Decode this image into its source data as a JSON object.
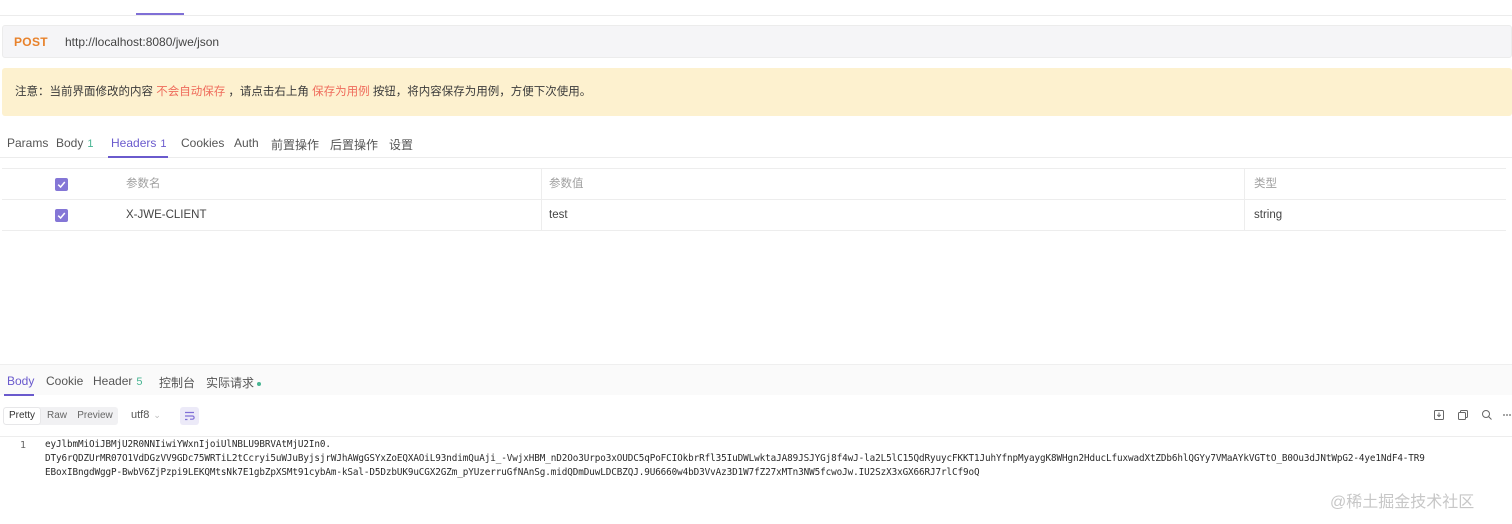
{
  "request": {
    "method": "POST",
    "url": "http://localhost:8080/jwe/json"
  },
  "notice": {
    "prefix": "注意：当前界面修改的内容",
    "warn": "不会自动保存",
    "middle": "，请点击右上角",
    "action": "保存为用例",
    "suffix": "按钮，将内容保存为用例，方便下次使用。"
  },
  "request_tabs": [
    {
      "label": "Params",
      "count": ""
    },
    {
      "label": "Body",
      "count": "1"
    },
    {
      "label": "Headers",
      "count": "1"
    },
    {
      "label": "Cookies",
      "count": ""
    },
    {
      "label": "Auth",
      "count": ""
    },
    {
      "label": "前置操作",
      "count": ""
    },
    {
      "label": "后置操作",
      "count": ""
    },
    {
      "label": "设置",
      "count": ""
    }
  ],
  "headers_table": {
    "columns": [
      "参数名",
      "参数值",
      "类型"
    ],
    "rows": [
      {
        "name": "X-JWE-CLIENT",
        "value": "test",
        "type": "string",
        "checked": true
      }
    ]
  },
  "response_tabs": [
    {
      "label": "Body",
      "count": ""
    },
    {
      "label": "Cookie",
      "count": ""
    },
    {
      "label": "Header",
      "count": "5"
    },
    {
      "label": "控制台",
      "count": ""
    },
    {
      "label": "实际请求",
      "count": ""
    }
  ],
  "response_view": {
    "modes": [
      "Pretty",
      "Raw",
      "Preview"
    ],
    "selected_mode": "Pretty",
    "encoding": "utf8"
  },
  "response_body": {
    "line_number": "1",
    "lines": [
      "eyJlbmMiOiJBMjU2R0NNIiwiYWxnIjoiUlNBLU9BRVAtMjU2In0.",
      "DTy6rQDZUrMR07O1VdDGzVV9GDc75WRTiL2tCcryi5uWJuByjsjrWJhAWgGSYxZoEQXAOiL93ndimQuAji_-VwjxHBM_nD2Oo3Urpo3xOUDC5qPoFCIOkbrRfl35IuDWLwktaJA89JSJYGj8f4wJ-la2L5lC15QdRyuycFKKT1JuhYfnpMyaygK8WHgn2HducLfuxwadXtZDb6hlQGYy7VMaAYkVGTtO_B0Ou3dJNtWpG2-4ye1NdF4-TR9",
      "EBoxIBngdWggP-BwbV6ZjPzpi9LEKQMtsNk7E1gbZpXSMt91cybAm-kSal-D5DzbUK9uCGX2GZm_pYUzerruGfNAnSg.midQDmDuwLDCBZQJ.9U6660w4bD3VvAz3D1W7fZ27xMTn3NW5fcwoJw.IU2SzX3xGX66RJ7rlCf9oQ"
    ]
  },
  "watermark": "@稀土掘金技术社区",
  "colors": {
    "accent": "#6a5acd",
    "method": "#e8822b",
    "notice_bg": "#fdf1cf",
    "warn_text": "#ef6b5b",
    "count": "#48b593"
  }
}
